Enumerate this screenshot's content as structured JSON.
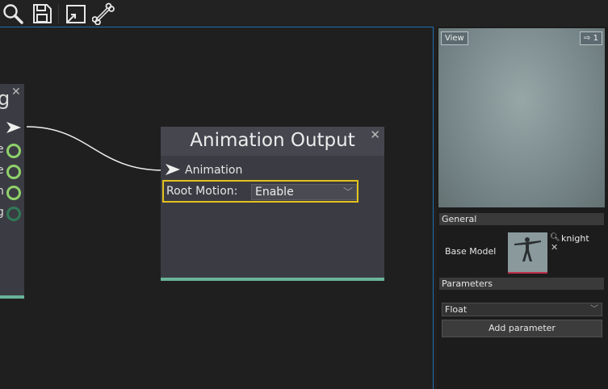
{
  "toolbar": {
    "tools": [
      "search-icon",
      "save-icon",
      "resize-icon",
      "bone-icon"
    ]
  },
  "graph": {
    "left_node": {
      "title_fragment": "g",
      "pins": [
        "e",
        "e",
        "n",
        "g"
      ]
    },
    "output_node": {
      "title": "Animation Output",
      "input_label": "Animation",
      "root_motion_label": "Root Motion:",
      "root_motion_value": "Enable"
    },
    "colors": {
      "node_bg": "#3b3c43",
      "accent": "#69b39a",
      "highlight": "#e4c21b",
      "pin": "#8fd16a"
    }
  },
  "inspector": {
    "preview": {
      "view_button": "View",
      "destination_count": "1"
    },
    "general": {
      "header": "General",
      "base_model_label": "Base Model",
      "model_name": "knight"
    },
    "parameters": {
      "header": "Parameters",
      "type_value": "Float",
      "add_button": "Add parameter"
    }
  }
}
